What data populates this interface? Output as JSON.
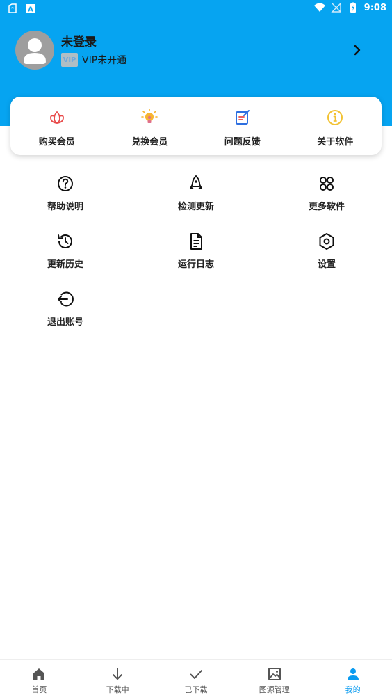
{
  "statusbar": {
    "time": "9:08"
  },
  "profile": {
    "name": "未登录",
    "vip_badge": "VIP",
    "vip_status": "VIP未开通"
  },
  "quick_actions": [
    {
      "label": "购买会员",
      "icon": "lotus-icon"
    },
    {
      "label": "兑换会员",
      "icon": "lightbulb-icon"
    },
    {
      "label": "问题反馈",
      "icon": "edit-note-icon"
    },
    {
      "label": "关于软件",
      "icon": "info-icon"
    }
  ],
  "menu": [
    {
      "label": "帮助说明",
      "icon": "help-circle-icon"
    },
    {
      "label": "检测更新",
      "icon": "rocket-icon"
    },
    {
      "label": "更多软件",
      "icon": "apps-icon"
    },
    {
      "label": "更新历史",
      "icon": "history-icon"
    },
    {
      "label": "运行日志",
      "icon": "document-icon"
    },
    {
      "label": "设置",
      "icon": "settings-hexagon-icon"
    },
    {
      "label": "退出账号",
      "icon": "logout-icon"
    }
  ],
  "bottom_nav": [
    {
      "label": "首页",
      "icon": "home-icon"
    },
    {
      "label": "下载中",
      "icon": "download-arrow-icon"
    },
    {
      "label": "已下载",
      "icon": "check-icon"
    },
    {
      "label": "图源管理",
      "icon": "image-icon"
    },
    {
      "label": "我的",
      "icon": "person-icon",
      "active": true
    }
  ],
  "colors": {
    "primary": "#06A4F1",
    "active_nav": "#0A9BF0"
  }
}
